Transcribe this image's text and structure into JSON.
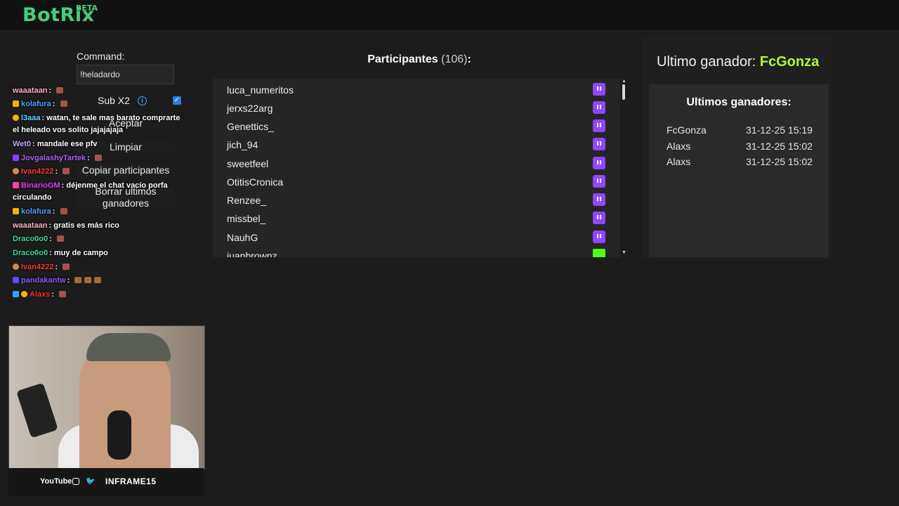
{
  "app": {
    "logo": "BotRix",
    "beta": "BETA"
  },
  "controls": {
    "command_label": "Command:",
    "command_value": "!heladardo",
    "sub_label": "Sub X2",
    "sub_checked": true,
    "buttons": [
      "Aceptar",
      "Limpiar",
      "Copiar participantes",
      "Borrar ultimos ganadores"
    ]
  },
  "chat": [
    {
      "user": "waaataan",
      "color": "#ffb3c6",
      "msg": ""
    },
    {
      "user": "kolafura",
      "color": "#4aa3ff",
      "msg": ""
    },
    {
      "user": "l3aaa",
      "color": "#6fd3ff",
      "msg": "watan, te sale mas barato comprarte el heleado vos solito jajajajaja"
    },
    {
      "user": "Wet0",
      "color": "#c7a6ff",
      "msg": "mandale ese pfv"
    },
    {
      "user": "JovgalashyTartek",
      "color": "#b45cff",
      "msg": ""
    },
    {
      "user": "Ivan4222",
      "color": "#ff3b3b",
      "msg": ""
    },
    {
      "user": "BinarioGM",
      "color": "#e040fb",
      "msg": "déjenme el chat vacío porfa circulando"
    },
    {
      "user": "kolafura",
      "color": "#4aa3ff",
      "msg": ""
    },
    {
      "user": "waaataan",
      "color": "#ffb3c6",
      "msg": "gratis es más rico"
    },
    {
      "user": "Draco0o0",
      "color": "#3ddc97",
      "msg": ""
    },
    {
      "user": "Draco0o0",
      "color": "#3ddc97",
      "msg": "muy de campo"
    },
    {
      "user": "Ivan4222",
      "color": "#ff3b3b",
      "msg": ""
    },
    {
      "user": "pandakantw",
      "color": "#8a5cff",
      "msg": ""
    },
    {
      "user": "Alaxs",
      "color": "#ff3030",
      "msg": ""
    }
  ],
  "participants": {
    "title": "Participantes",
    "count": "(106)",
    "suffix": ":",
    "items": [
      {
        "name": "luca_numeritos",
        "platform": "twitch"
      },
      {
        "name": "jerxs22arg",
        "platform": "twitch"
      },
      {
        "name": "Genettics_",
        "platform": "twitch"
      },
      {
        "name": "jich_94",
        "platform": "twitch"
      },
      {
        "name": "sweetfeel",
        "platform": "twitch"
      },
      {
        "name": "OtitisCronica",
        "platform": "twitch"
      },
      {
        "name": "Renzee_",
        "platform": "twitch"
      },
      {
        "name": "missbel_",
        "platform": "twitch"
      },
      {
        "name": "NauhG",
        "platform": "twitch"
      },
      {
        "name": "juanbrownz",
        "platform": "kick"
      }
    ]
  },
  "winner": {
    "label": "Ultimo ganador:",
    "name": "FcGonza",
    "history_title": "Ultimos ganadores:",
    "history": [
      {
        "name": "FcGonza",
        "date": "31-12-25 15:19"
      },
      {
        "name": "Alaxs",
        "date": "31-12-25 15:02"
      },
      {
        "name": "Alaxs",
        "date": "31-12-25 15:02"
      }
    ]
  },
  "cam_footer": {
    "youtube": "YouTube",
    "handle": "INFRAME15"
  }
}
